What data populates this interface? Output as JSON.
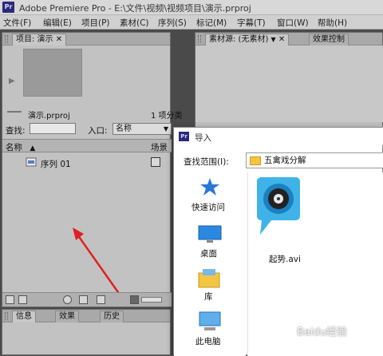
{
  "window": {
    "app_logo": "Pr",
    "title": "Adobe Premiere Pro - E:\\文件\\视频\\视频项目\\演示.prproj"
  },
  "menu": [
    "文件(F)",
    "编辑(E)",
    "项目(P)",
    "素材(C)",
    "序列(S)",
    "标记(M)",
    "字幕(T)",
    "窗口(W)",
    "帮助(H)"
  ],
  "project_panel": {
    "tab_label": "项目: 演示",
    "clip_name": "演示.prproj",
    "item_count": "1 项分类",
    "search_label": "查找:",
    "search_value": "",
    "inpoint_label": "入口:",
    "inpoint_value": "名称",
    "column_name": "名称",
    "column_scene": "场景",
    "sequence_item": "序列 01"
  },
  "info_panel": {
    "tabs": [
      "信息",
      "效果",
      "历史"
    ]
  },
  "source_panel": {
    "tab_label": "素材源: (无素材)",
    "tab2_label": "效果控制"
  },
  "import_dialog": {
    "logo": "Pr",
    "title": "导入",
    "look_in_label": "查找范围(I):",
    "look_in_value": "五禽戏分解",
    "places": [
      "快速访问",
      "桌面",
      "库",
      "此电脑"
    ],
    "file_name": "起势.avi"
  },
  "watermark": "Baidu经验",
  "colors": {
    "annotation_arrow": "#e02020",
    "pr_brand": "#2b2a78",
    "folder": "#f4c542"
  }
}
